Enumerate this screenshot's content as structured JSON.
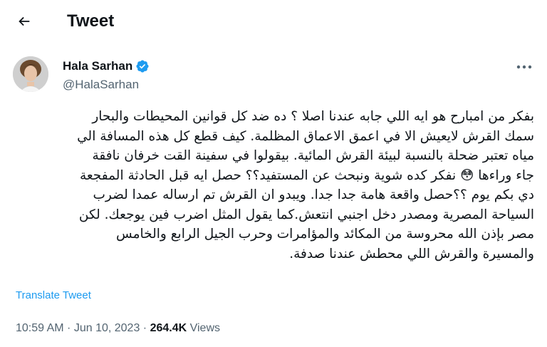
{
  "header": {
    "title": "Tweet",
    "back_icon": "arrow-left-icon"
  },
  "author": {
    "name": "Hala Sarhan",
    "handle": "@HalaSarhan",
    "verified": true,
    "verified_color": "#1d9bf0",
    "more_icon": "more-dots-icon"
  },
  "tweet": {
    "lines": [
      "بفكر من امبارح هو ايه اللي جابه عندنا اصلا ؟ ده ضد كل قوانين المحيطات والبحار",
      "سمك القرش لايعيش الا في اعمق الاعماق المظلمة. كيف قطع كل هذه المسافة الي",
      "مياه تعتبر ضحلة بالنسبة لبيئة القرش المائية. بيقولوا في سفينة القت خرفان نافقة",
      "جاء وراءها 😳 نفكر كده شوية ونبحث عن المستفيد؟؟ حصل ايه قبل الحادثة المفجعة",
      "دي بكم يوم ؟؟حصل واقعة هامة جدا جدا. ويبدو ان القرش تم ارساله عمدا لضرب",
      "السياحة المصرية ومصدر دخل اجنبي انتعش.كما يقول المثل اضرب فين يوجعك. لكن",
      "مصر بإذن الله محروسة من المكائد والمؤامرات وحرب الجيل الرابع والخامس",
      "والمسيرة والقرش اللي محطش عندنا صدفة."
    ],
    "translate_label": "Translate Tweet"
  },
  "meta": {
    "time": "10:59 AM",
    "separator": " · ",
    "date": "Jun 10, 2023",
    "views_count": "264.4K",
    "views_label": " Views"
  },
  "colors": {
    "text": "#0f1419",
    "secondary": "#536471",
    "link": "#1d9bf0"
  }
}
